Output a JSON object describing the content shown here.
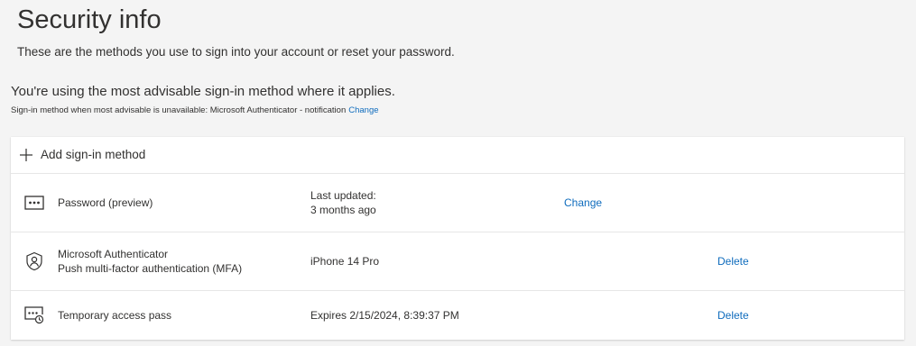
{
  "header": {
    "title": "Security info",
    "subtitle": "These are the methods you use to sign into your account or reset your password."
  },
  "advisable": {
    "heading": "You're using the most advisable sign-in method where it applies.",
    "note_prefix": "Sign-in method when most advisable is unavailable: Microsoft Authenticator - notification",
    "change_label": "Change"
  },
  "methods_card": {
    "add_label": "Add sign-in method",
    "items": [
      {
        "icon": "password-dots-icon",
        "name_line1": "Password (preview)",
        "name_line2": "",
        "detail_line1": "Last updated:",
        "detail_line2": "3 months ago",
        "action": "Change"
      },
      {
        "icon": "authenticator-icon",
        "name_line1": "Microsoft Authenticator",
        "name_line2": "Push multi-factor authentication (MFA)",
        "detail_line1": "iPhone 14 Pro",
        "detail_line2": "",
        "action": "Delete"
      },
      {
        "icon": "temporary-access-pass-icon",
        "name_line1": "Temporary access pass",
        "name_line2": "",
        "detail_line1": "Expires 2/15/2024, 8:39:37 PM",
        "detail_line2": "",
        "action": "Delete"
      }
    ]
  },
  "colors": {
    "background": "#f4f4f4",
    "card": "#ffffff",
    "text": "#323130",
    "link": "#0f6cbd",
    "divider": "#e6e6e6"
  }
}
